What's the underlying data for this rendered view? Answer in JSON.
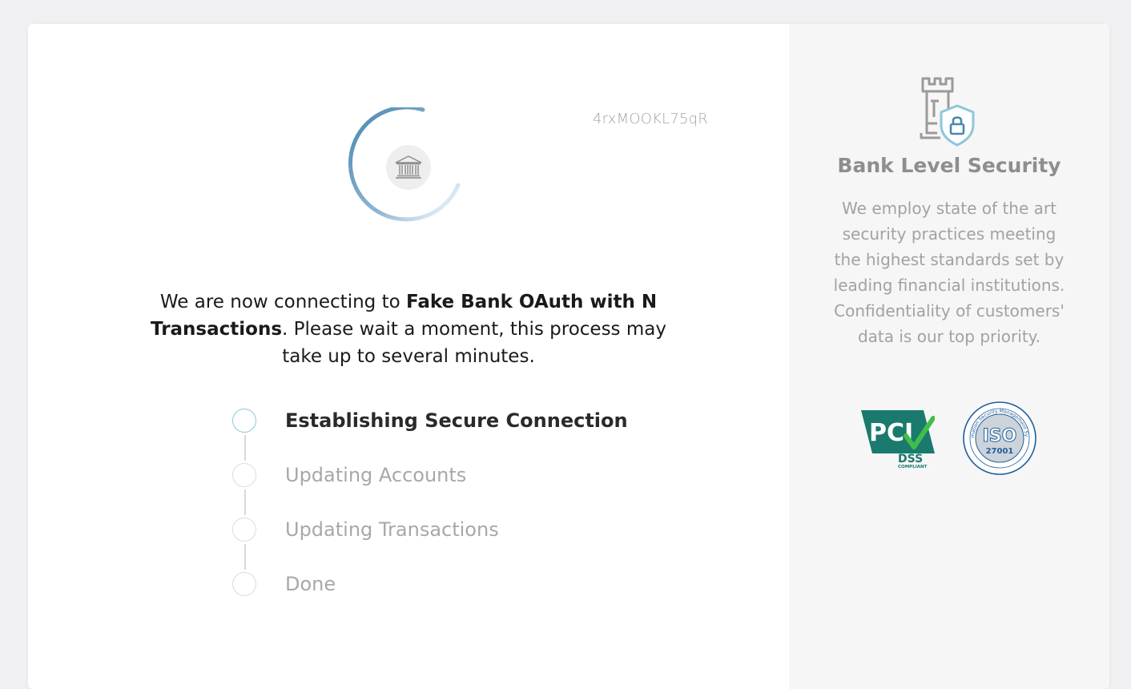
{
  "request_id": "4rxMOOKL75qR",
  "message": {
    "prefix": "We are now connecting to ",
    "bank_name": "Fake Bank OAuth with N Transactions",
    "suffix": ". Please wait a moment, this process may take up to several minutes."
  },
  "steps": [
    {
      "label": "Establishing Secure Connection",
      "state": "active"
    },
    {
      "label": "Updating Accounts",
      "state": "pending"
    },
    {
      "label": "Updating Transactions",
      "state": "pending"
    },
    {
      "label": "Done",
      "state": "pending"
    }
  ],
  "security": {
    "title": "Bank Level Security",
    "description": "We employ state of the art security practices meeting the highest standards set by leading financial institutions. Confidentiality of customers' data is our top priority."
  },
  "badges": {
    "pci": {
      "main": "PCI",
      "sub": "DSS",
      "small": "COMPLIANT"
    },
    "iso": {
      "main": "ISO",
      "number": "27001",
      "ring_text": "Information Security Management System"
    }
  },
  "colors": {
    "accent": "#4a86b0",
    "active_step_ring": "#8ec6dc",
    "pci_green": "#1a7a6e",
    "check_green": "#3fbf4a",
    "iso_blue": "#1e5f9c"
  },
  "icons": {
    "spinner": "loading-spinner",
    "bank": "bank-icon",
    "security": "castle-shield-lock-icon"
  }
}
